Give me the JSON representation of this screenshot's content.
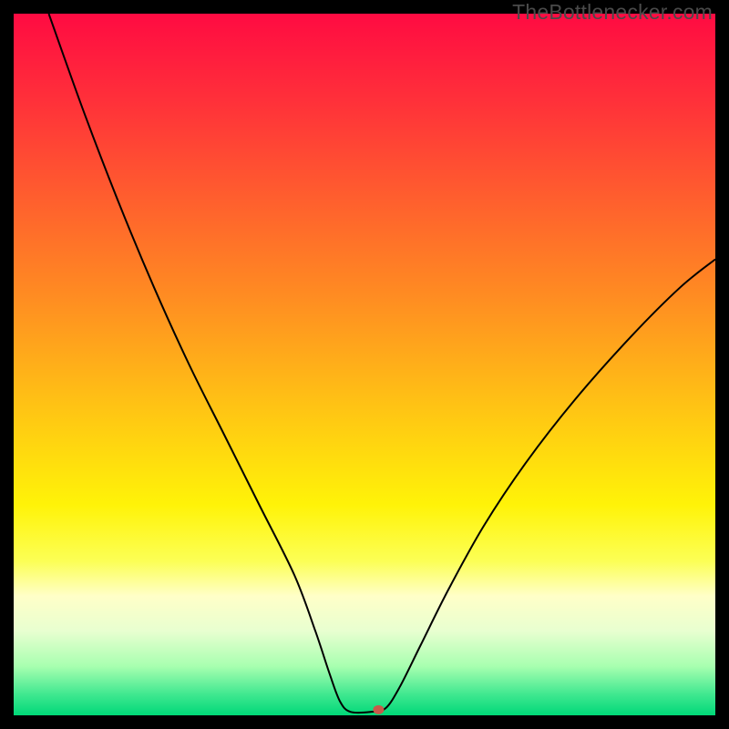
{
  "watermark": "TheBottlenecker.com",
  "chart_data": {
    "type": "line",
    "title": "",
    "xlabel": "",
    "ylabel": "",
    "xlim": [
      0,
      100
    ],
    "ylim": [
      0,
      100
    ],
    "background": {
      "type": "vertical-gradient",
      "stops": [
        {
          "pos": 0.0,
          "color": "#ff0b42"
        },
        {
          "pos": 0.12,
          "color": "#ff2f3a"
        },
        {
          "pos": 0.25,
          "color": "#ff5a2f"
        },
        {
          "pos": 0.4,
          "color": "#ff8b22"
        },
        {
          "pos": 0.55,
          "color": "#ffc015"
        },
        {
          "pos": 0.7,
          "color": "#fff308"
        },
        {
          "pos": 0.78,
          "color": "#fcff55"
        },
        {
          "pos": 0.83,
          "color": "#ffffc8"
        },
        {
          "pos": 0.88,
          "color": "#e8ffd0"
        },
        {
          "pos": 0.93,
          "color": "#a8ffb0"
        },
        {
          "pos": 0.97,
          "color": "#40e890"
        },
        {
          "pos": 1.0,
          "color": "#00d878"
        }
      ]
    },
    "series": [
      {
        "name": "bottleneck-curve",
        "color": "#000000",
        "width": 2,
        "points": [
          {
            "x": 5.0,
            "y": 100.0
          },
          {
            "x": 10.0,
            "y": 86.0
          },
          {
            "x": 15.0,
            "y": 73.0
          },
          {
            "x": 20.0,
            "y": 61.0
          },
          {
            "x": 25.0,
            "y": 50.0
          },
          {
            "x": 30.0,
            "y": 40.0
          },
          {
            "x": 35.0,
            "y": 30.0
          },
          {
            "x": 40.0,
            "y": 20.0
          },
          {
            "x": 43.0,
            "y": 12.0
          },
          {
            "x": 45.0,
            "y": 6.0
          },
          {
            "x": 46.5,
            "y": 2.0
          },
          {
            "x": 48.0,
            "y": 0.5
          },
          {
            "x": 51.0,
            "y": 0.5
          },
          {
            "x": 53.0,
            "y": 1.0
          },
          {
            "x": 55.0,
            "y": 4.0
          },
          {
            "x": 58.0,
            "y": 10.0
          },
          {
            "x": 62.0,
            "y": 18.0
          },
          {
            "x": 67.0,
            "y": 27.0
          },
          {
            "x": 73.0,
            "y": 36.0
          },
          {
            "x": 80.0,
            "y": 45.0
          },
          {
            "x": 88.0,
            "y": 54.0
          },
          {
            "x": 95.0,
            "y": 61.0
          },
          {
            "x": 100.0,
            "y": 65.0
          }
        ]
      }
    ],
    "marker": {
      "name": "optimal-point",
      "x": 52.0,
      "y": 0.8,
      "color": "#c85a4a",
      "rx": 6,
      "ry": 5
    }
  }
}
